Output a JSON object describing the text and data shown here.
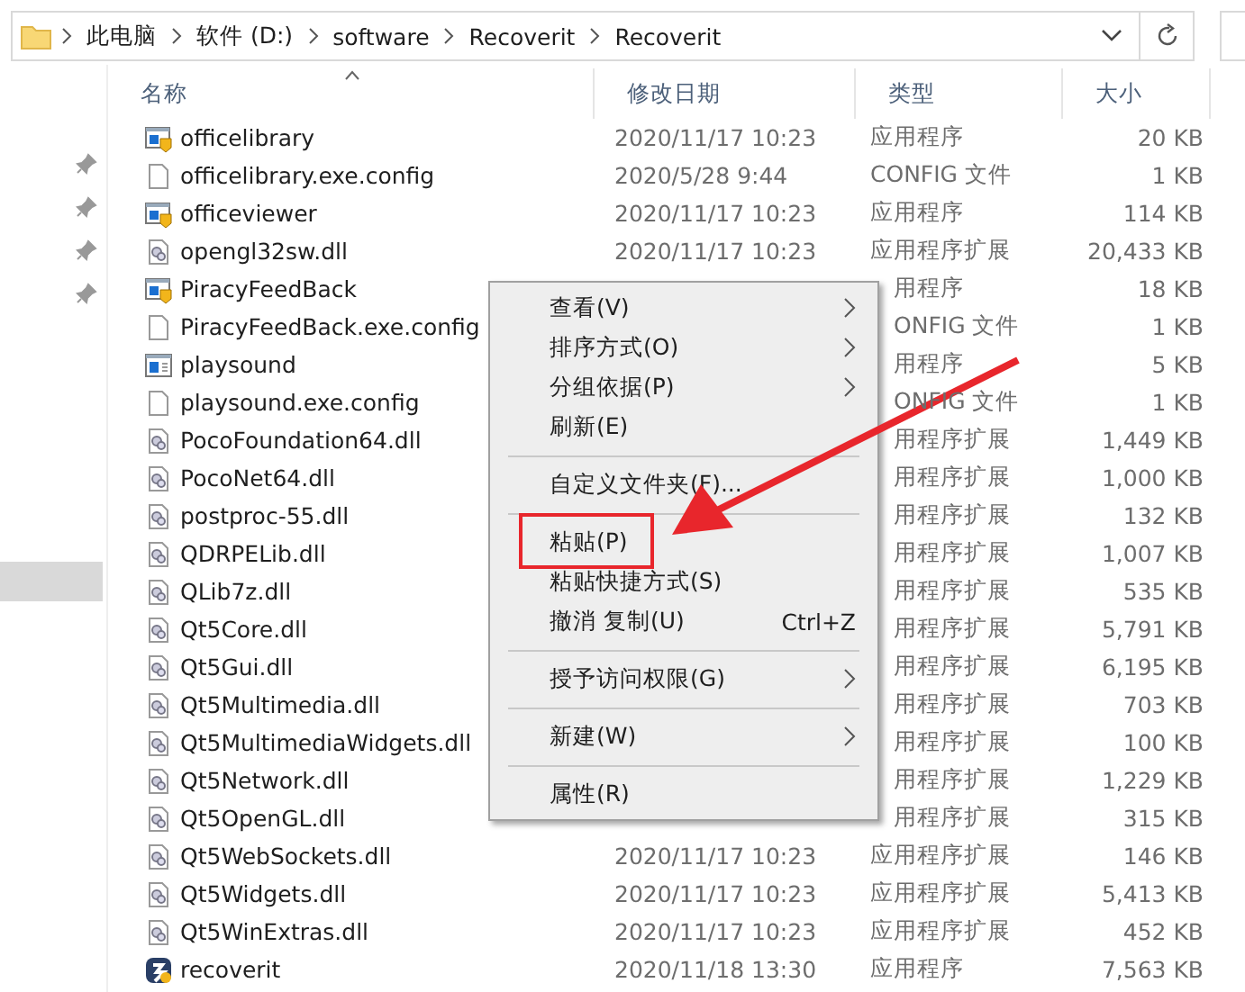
{
  "address": {
    "crumbs": [
      "此电脑",
      "软件 (D:)",
      "software",
      "Recoverit",
      "Recoverit"
    ]
  },
  "columns": [
    {
      "label": "名称",
      "sorted": true
    },
    {
      "label": "修改日期",
      "sorted": false
    },
    {
      "label": "类型",
      "sorted": false
    },
    {
      "label": "大小",
      "sorted": false
    }
  ],
  "files": [
    {
      "name": "officelibrary",
      "kind": "exe",
      "date": "2020/11/17 10:23",
      "type": "应用程序",
      "size": "20 KB"
    },
    {
      "name": "officelibrary.exe.config",
      "kind": "config",
      "date": "2020/5/28 9:44",
      "type": "CONFIG 文件",
      "size": "1 KB"
    },
    {
      "name": "officeviewer",
      "kind": "exe",
      "date": "2020/11/17 10:23",
      "type": "应用程序",
      "size": "114 KB"
    },
    {
      "name": "opengl32sw.dll",
      "kind": "dll",
      "date": "2020/11/17 10:23",
      "type": "应用程序扩展",
      "size": "20,433 KB"
    },
    {
      "name": "PiracyFeedBack",
      "kind": "exe",
      "type": "用程序",
      "size": "18 KB"
    },
    {
      "name": "PiracyFeedBack.exe.config",
      "kind": "config",
      "type": "ONFIG 文件",
      "size": "1 KB"
    },
    {
      "name": "playsound",
      "kind": "window",
      "type": "用程序",
      "size": "5 KB"
    },
    {
      "name": "playsound.exe.config",
      "kind": "config",
      "type": "ONFIG 文件",
      "size": "1 KB"
    },
    {
      "name": "PocoFoundation64.dll",
      "kind": "dll",
      "type": "用程序扩展",
      "size": "1,449 KB"
    },
    {
      "name": "PocoNet64.dll",
      "kind": "dll",
      "type": "用程序扩展",
      "size": "1,000 KB"
    },
    {
      "name": "postproc-55.dll",
      "kind": "dll",
      "type": "用程序扩展",
      "size": "132 KB"
    },
    {
      "name": "QDRPELib.dll",
      "kind": "dll",
      "type": "用程序扩展",
      "size": "1,007 KB"
    },
    {
      "name": "QLib7z.dll",
      "kind": "dll",
      "type": "用程序扩展",
      "size": "535 KB"
    },
    {
      "name": "Qt5Core.dll",
      "kind": "dll",
      "type": "用程序扩展",
      "size": "5,791 KB"
    },
    {
      "name": "Qt5Gui.dll",
      "kind": "dll",
      "type": "用程序扩展",
      "size": "6,195 KB"
    },
    {
      "name": "Qt5Multimedia.dll",
      "kind": "dll",
      "type": "用程序扩展",
      "size": "703 KB"
    },
    {
      "name": "Qt5MultimediaWidgets.dll",
      "kind": "dll",
      "type": "用程序扩展",
      "size": "100 KB"
    },
    {
      "name": "Qt5Network.dll",
      "kind": "dll",
      "type": "用程序扩展",
      "size": "1,229 KB"
    },
    {
      "name": "Qt5OpenGL.dll",
      "kind": "dll",
      "type": "用程序扩展",
      "size": "315 KB"
    },
    {
      "name": "Qt5WebSockets.dll",
      "kind": "dll",
      "date": "2020/11/17 10:23",
      "type": "应用程序扩展",
      "size": "146 KB"
    },
    {
      "name": "Qt5Widgets.dll",
      "kind": "dll",
      "date": "2020/11/17 10:23",
      "type": "应用程序扩展",
      "size": "5,413 KB"
    },
    {
      "name": "Qt5WinExtras.dll",
      "kind": "dll",
      "date": "2020/11/17 10:23",
      "type": "应用程序扩展",
      "size": "452 KB"
    },
    {
      "name": "recoverit",
      "kind": "app",
      "date": "2020/11/18 13:30",
      "type": "应用程序",
      "size": "7,563 KB"
    }
  ],
  "context_menu": [
    {
      "kind": "item",
      "label": "查看(V)",
      "submenu": true
    },
    {
      "kind": "item",
      "label": "排序方式(O)",
      "submenu": true
    },
    {
      "kind": "item",
      "label": "分组依据(P)",
      "submenu": true
    },
    {
      "kind": "item",
      "label": "刷新(E)",
      "submenu": false
    },
    {
      "kind": "separator"
    },
    {
      "kind": "item",
      "label": "自定义文件夹(F)...",
      "submenu": false
    },
    {
      "kind": "separator"
    },
    {
      "kind": "item",
      "label": "粘贴(P)",
      "submenu": false,
      "highlighted": true
    },
    {
      "kind": "item",
      "label": "粘贴快捷方式(S)",
      "submenu": false
    },
    {
      "kind": "item",
      "label": "撤消 复制(U)",
      "submenu": false,
      "shortcut": "Ctrl+Z"
    },
    {
      "kind": "separator"
    },
    {
      "kind": "item",
      "label": "授予访问权限(G)",
      "submenu": true
    },
    {
      "kind": "separator"
    },
    {
      "kind": "item",
      "label": "新建(W)",
      "submenu": true
    },
    {
      "kind": "separator"
    },
    {
      "kind": "item",
      "label": "属性(R)",
      "submenu": false
    }
  ]
}
